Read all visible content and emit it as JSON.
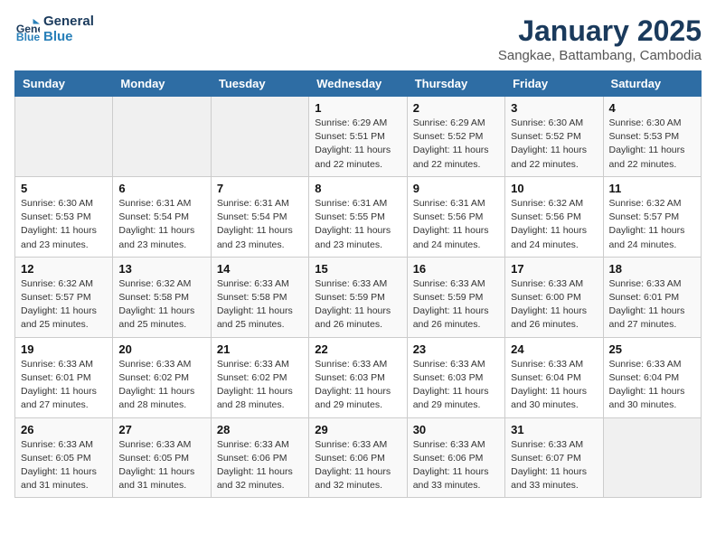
{
  "logo": {
    "line1": "General",
    "line2": "Blue"
  },
  "title": "January 2025",
  "subtitle": "Sangkae, Battambang, Cambodia",
  "days_of_week": [
    "Sunday",
    "Monday",
    "Tuesday",
    "Wednesday",
    "Thursday",
    "Friday",
    "Saturday"
  ],
  "weeks": [
    [
      {
        "day": "",
        "info": ""
      },
      {
        "day": "",
        "info": ""
      },
      {
        "day": "",
        "info": ""
      },
      {
        "day": "1",
        "info": "Sunrise: 6:29 AM\nSunset: 5:51 PM\nDaylight: 11 hours and 22 minutes."
      },
      {
        "day": "2",
        "info": "Sunrise: 6:29 AM\nSunset: 5:52 PM\nDaylight: 11 hours and 22 minutes."
      },
      {
        "day": "3",
        "info": "Sunrise: 6:30 AM\nSunset: 5:52 PM\nDaylight: 11 hours and 22 minutes."
      },
      {
        "day": "4",
        "info": "Sunrise: 6:30 AM\nSunset: 5:53 PM\nDaylight: 11 hours and 22 minutes."
      }
    ],
    [
      {
        "day": "5",
        "info": "Sunrise: 6:30 AM\nSunset: 5:53 PM\nDaylight: 11 hours and 23 minutes."
      },
      {
        "day": "6",
        "info": "Sunrise: 6:31 AM\nSunset: 5:54 PM\nDaylight: 11 hours and 23 minutes."
      },
      {
        "day": "7",
        "info": "Sunrise: 6:31 AM\nSunset: 5:54 PM\nDaylight: 11 hours and 23 minutes."
      },
      {
        "day": "8",
        "info": "Sunrise: 6:31 AM\nSunset: 5:55 PM\nDaylight: 11 hours and 23 minutes."
      },
      {
        "day": "9",
        "info": "Sunrise: 6:31 AM\nSunset: 5:56 PM\nDaylight: 11 hours and 24 minutes."
      },
      {
        "day": "10",
        "info": "Sunrise: 6:32 AM\nSunset: 5:56 PM\nDaylight: 11 hours and 24 minutes."
      },
      {
        "day": "11",
        "info": "Sunrise: 6:32 AM\nSunset: 5:57 PM\nDaylight: 11 hours and 24 minutes."
      }
    ],
    [
      {
        "day": "12",
        "info": "Sunrise: 6:32 AM\nSunset: 5:57 PM\nDaylight: 11 hours and 25 minutes."
      },
      {
        "day": "13",
        "info": "Sunrise: 6:32 AM\nSunset: 5:58 PM\nDaylight: 11 hours and 25 minutes."
      },
      {
        "day": "14",
        "info": "Sunrise: 6:33 AM\nSunset: 5:58 PM\nDaylight: 11 hours and 25 minutes."
      },
      {
        "day": "15",
        "info": "Sunrise: 6:33 AM\nSunset: 5:59 PM\nDaylight: 11 hours and 26 minutes."
      },
      {
        "day": "16",
        "info": "Sunrise: 6:33 AM\nSunset: 5:59 PM\nDaylight: 11 hours and 26 minutes."
      },
      {
        "day": "17",
        "info": "Sunrise: 6:33 AM\nSunset: 6:00 PM\nDaylight: 11 hours and 26 minutes."
      },
      {
        "day": "18",
        "info": "Sunrise: 6:33 AM\nSunset: 6:01 PM\nDaylight: 11 hours and 27 minutes."
      }
    ],
    [
      {
        "day": "19",
        "info": "Sunrise: 6:33 AM\nSunset: 6:01 PM\nDaylight: 11 hours and 27 minutes."
      },
      {
        "day": "20",
        "info": "Sunrise: 6:33 AM\nSunset: 6:02 PM\nDaylight: 11 hours and 28 minutes."
      },
      {
        "day": "21",
        "info": "Sunrise: 6:33 AM\nSunset: 6:02 PM\nDaylight: 11 hours and 28 minutes."
      },
      {
        "day": "22",
        "info": "Sunrise: 6:33 AM\nSunset: 6:03 PM\nDaylight: 11 hours and 29 minutes."
      },
      {
        "day": "23",
        "info": "Sunrise: 6:33 AM\nSunset: 6:03 PM\nDaylight: 11 hours and 29 minutes."
      },
      {
        "day": "24",
        "info": "Sunrise: 6:33 AM\nSunset: 6:04 PM\nDaylight: 11 hours and 30 minutes."
      },
      {
        "day": "25",
        "info": "Sunrise: 6:33 AM\nSunset: 6:04 PM\nDaylight: 11 hours and 30 minutes."
      }
    ],
    [
      {
        "day": "26",
        "info": "Sunrise: 6:33 AM\nSunset: 6:05 PM\nDaylight: 11 hours and 31 minutes."
      },
      {
        "day": "27",
        "info": "Sunrise: 6:33 AM\nSunset: 6:05 PM\nDaylight: 11 hours and 31 minutes."
      },
      {
        "day": "28",
        "info": "Sunrise: 6:33 AM\nSunset: 6:06 PM\nDaylight: 11 hours and 32 minutes."
      },
      {
        "day": "29",
        "info": "Sunrise: 6:33 AM\nSunset: 6:06 PM\nDaylight: 11 hours and 32 minutes."
      },
      {
        "day": "30",
        "info": "Sunrise: 6:33 AM\nSunset: 6:06 PM\nDaylight: 11 hours and 33 minutes."
      },
      {
        "day": "31",
        "info": "Sunrise: 6:33 AM\nSunset: 6:07 PM\nDaylight: 11 hours and 33 minutes."
      },
      {
        "day": "",
        "info": ""
      }
    ]
  ]
}
